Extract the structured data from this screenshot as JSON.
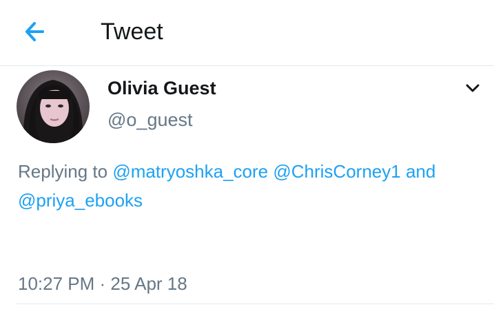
{
  "header": {
    "back_icon": "arrow-left-icon",
    "title": "Tweet"
  },
  "tweet": {
    "author_name": "Olivia Guest",
    "author_handle": "@o_guest",
    "menu_icon": "chevron-down-icon",
    "replying_prefix": "Replying to",
    "mentions": [
      "@matryoshka_core",
      "@ChrisCorney1",
      "@priya_ebooks"
    ],
    "replying_joiner": "and",
    "timestamp": "10:27 PM · 25 Apr 18"
  },
  "colors": {
    "accent": "#1da1f2",
    "text_primary": "#14171a",
    "text_secondary": "#657786",
    "divider": "#e1e8ed"
  }
}
